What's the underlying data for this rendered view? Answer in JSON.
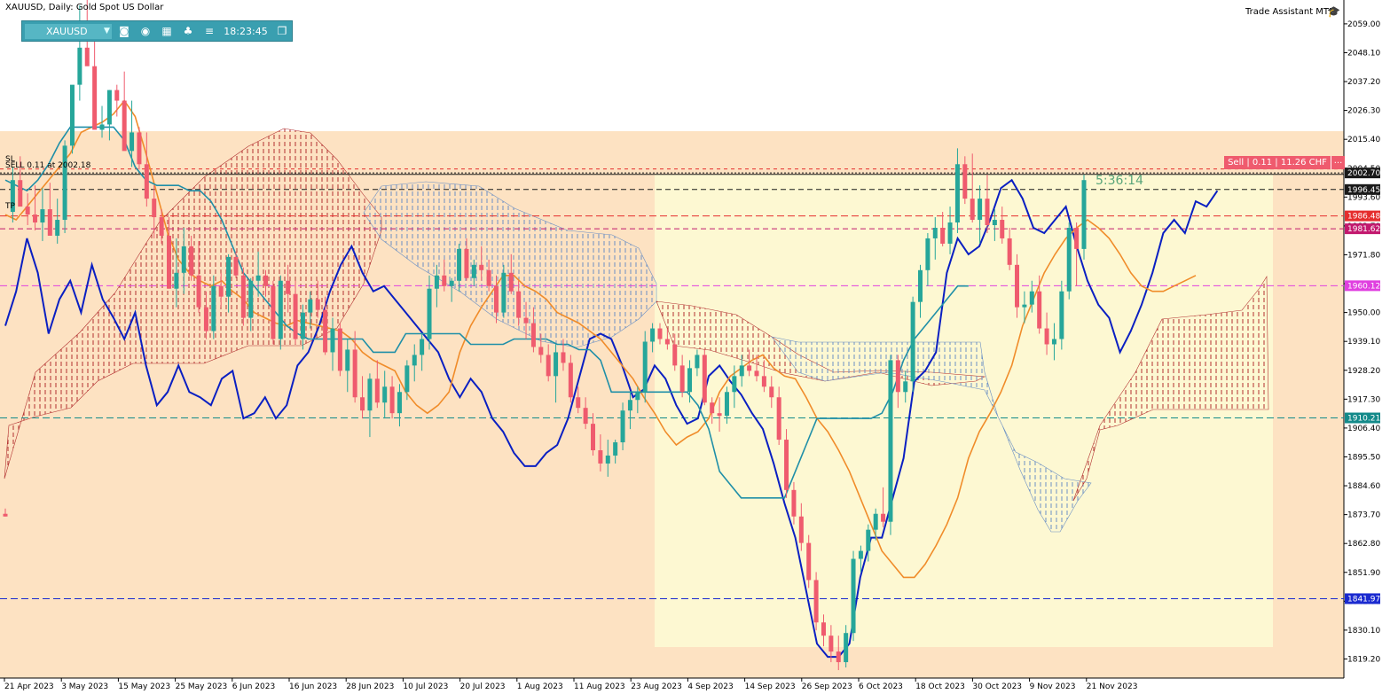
{
  "header": {
    "title": "XAUUSD, Daily:  Gold Spot US Dollar",
    "assistant": "Trade Assistant MT5"
  },
  "toolbar": {
    "symbol": "XAUUSD",
    "time": "18:23:45",
    "icons": [
      "camera-icon",
      "eye-icon",
      "calendar-icon",
      "bell-icon",
      "menu-icon",
      "window-icon"
    ]
  },
  "trade": {
    "sell_box": "Sell | 0.11 | 11.26 CHF",
    "sell_box_close": "...",
    "sl_label": "SL",
    "sell_label": "SELL 0.11 at 2002.18",
    "tp_label": "TP",
    "timer": "5:36:14"
  },
  "chart_data": {
    "type": "candlestick",
    "title": "XAUUSD, Daily:  Gold Spot US Dollar",
    "ylim": [
      1812,
      2068
    ],
    "y_ticks": [
      "2059.00",
      "2048.10",
      "2037.20",
      "2026.30",
      "2015.40",
      "2004.50",
      "1993.60",
      "1982.70",
      "1971.80",
      "1960.90",
      "1950.00",
      "1939.10",
      "1928.20",
      "1917.30",
      "1906.40",
      "1895.50",
      "1884.60",
      "1873.70",
      "1862.80",
      "1851.90",
      "1841.00",
      "1830.10",
      "1819.20"
    ],
    "x_ticks": [
      "21 Apr 2023",
      "3 May 2023",
      "15 May 2023",
      "25 May 2023",
      "6 Jun 2023",
      "16 Jun 2023",
      "28 Jun 2023",
      "10 Jul 2023",
      "20 Jul 2023",
      "1 Aug 2023",
      "11 Aug 2023",
      "23 Aug 2023",
      "4 Sep 2023",
      "14 Sep 2023",
      "26 Sep 2023",
      "6 Oct 2023",
      "18 Oct 2023",
      "30 Oct 2023",
      "9 Nov 2023",
      "21 Nov 2023"
    ],
    "price_labels": [
      {
        "value": 2002.7,
        "text": "2002.70",
        "color": "#1a1a1a"
      },
      {
        "value": 1996.45,
        "text": "1996.45",
        "color": "#1a1a1a"
      },
      {
        "value": 1986.48,
        "text": "1986.48",
        "color": "#e52d2d"
      },
      {
        "value": 1981.62,
        "text": "1981.62",
        "color": "#c2186e"
      },
      {
        "value": 1960.12,
        "text": "1960.12",
        "color": "#e040e0"
      },
      {
        "value": 1910.21,
        "text": "1910.21",
        "color": "#138a8a"
      },
      {
        "value": 1841.97,
        "text": "1841.97",
        "color": "#1a2ad0"
      }
    ],
    "bull_color": "#26a69a",
    "bear_color": "#ef5b6e",
    "candles": [
      [
        1874,
        1876,
        1873,
        1873
      ],
      [
        1988,
        2005,
        1984,
        2000
      ],
      [
        2000,
        2009,
        1993,
        1990
      ],
      [
        1990,
        1995,
        1983,
        1987
      ],
      [
        1987,
        1998,
        1981,
        1984
      ],
      [
        1984,
        1997,
        1977,
        1989
      ],
      [
        1989,
        1999,
        1980,
        1979
      ],
      [
        1979,
        1993,
        1976,
        1985
      ],
      [
        1985,
        2015,
        1980,
        2013
      ],
      [
        2013,
        2032,
        2010,
        2036
      ],
      [
        2036,
        2066,
        2030,
        2050
      ],
      [
        2050,
        2072,
        2045,
        2043
      ],
      [
        2043,
        2056,
        2023,
        2019
      ],
      [
        2019,
        2028,
        2016,
        2021
      ],
      [
        2021,
        2034,
        2015,
        2034
      ],
      [
        2034,
        2036,
        2024,
        2030
      ],
      [
        2030,
        2041,
        2014,
        2011
      ],
      [
        2011,
        2030,
        2005,
        2018
      ],
      [
        2018,
        2020,
        2004,
        2006
      ],
      [
        2006,
        2018,
        1990,
        1993
      ],
      [
        1993,
        1998,
        1978,
        1986
      ],
      [
        1986,
        1989,
        1976,
        1979
      ],
      [
        1979,
        1986,
        1959,
        1959
      ],
      [
        1959,
        1978,
        1952,
        1965
      ],
      [
        1965,
        1982,
        1957,
        1975
      ],
      [
        1975,
        1979,
        1962,
        1964
      ],
      [
        1964,
        1977,
        1950,
        1952
      ],
      [
        1952,
        1958,
        1940,
        1943
      ],
      [
        1943,
        1964,
        1940,
        1960
      ],
      [
        1960,
        1965,
        1952,
        1956
      ],
      [
        1956,
        1972,
        1950,
        1971
      ],
      [
        1971,
        1973,
        1963,
        1964
      ],
      [
        1964,
        1967,
        1945,
        1948
      ],
      [
        1948,
        1963,
        1943,
        1962
      ],
      [
        1962,
        1973,
        1956,
        1964
      ],
      [
        1964,
        1966,
        1956,
        1960
      ],
      [
        1960,
        1962,
        1938,
        1940
      ],
      [
        1940,
        1964,
        1936,
        1962
      ],
      [
        1962,
        1968,
        1950,
        1957
      ],
      [
        1957,
        1962,
        1938,
        1940
      ],
      [
        1940,
        1953,
        1936,
        1950
      ],
      [
        1950,
        1958,
        1944,
        1955
      ],
      [
        1955,
        1962,
        1948,
        1951
      ],
      [
        1951,
        1956,
        1934,
        1935
      ],
      [
        1935,
        1948,
        1928,
        1944
      ],
      [
        1944,
        1946,
        1926,
        1928
      ],
      [
        1928,
        1940,
        1920,
        1936
      ],
      [
        1936,
        1943,
        1916,
        1918
      ],
      [
        1918,
        1926,
        1910,
        1913
      ],
      [
        1913,
        1927,
        1903,
        1925
      ],
      [
        1925,
        1932,
        1914,
        1916
      ],
      [
        1916,
        1928,
        1910,
        1922
      ],
      [
        1922,
        1926,
        1910,
        1912
      ],
      [
        1912,
        1923,
        1907,
        1920
      ],
      [
        1920,
        1932,
        1917,
        1930
      ],
      [
        1930,
        1938,
        1924,
        1934
      ],
      [
        1934,
        1942,
        1928,
        1940
      ],
      [
        1940,
        1964,
        1936,
        1959
      ],
      [
        1959,
        1968,
        1952,
        1964
      ],
      [
        1964,
        1970,
        1958,
        1960
      ],
      [
        1960,
        1963,
        1954,
        1962
      ],
      [
        1962,
        1976,
        1958,
        1974
      ],
      [
        1974,
        1978,
        1962,
        1963
      ],
      [
        1963,
        1970,
        1960,
        1968
      ],
      [
        1968,
        1975,
        1962,
        1966
      ],
      [
        1966,
        1970,
        1958,
        1960
      ],
      [
        1960,
        1964,
        1946,
        1950
      ],
      [
        1950,
        1968,
        1948,
        1965
      ],
      [
        1965,
        1972,
        1957,
        1958
      ],
      [
        1958,
        1962,
        1945,
        1948
      ],
      [
        1948,
        1954,
        1940,
        1946
      ],
      [
        1946,
        1952,
        1935,
        1937
      ],
      [
        1937,
        1942,
        1931,
        1934
      ],
      [
        1934,
        1938,
        1924,
        1926
      ],
      [
        1926,
        1938,
        1916,
        1935
      ],
      [
        1935,
        1940,
        1928,
        1931
      ],
      [
        1931,
        1934,
        1916,
        1918
      ],
      [
        1918,
        1922,
        1912,
        1914
      ],
      [
        1914,
        1918,
        1906,
        1908
      ],
      [
        1908,
        1912,
        1896,
        1898
      ],
      [
        1898,
        1904,
        1890,
        1893
      ],
      [
        1893,
        1902,
        1888,
        1896
      ],
      [
        1896,
        1902,
        1893,
        1901
      ],
      [
        1901,
        1916,
        1898,
        1913
      ],
      [
        1913,
        1920,
        1906,
        1917
      ],
      [
        1917,
        1922,
        1912,
        1920
      ],
      [
        1920,
        1943,
        1916,
        1939
      ],
      [
        1939,
        1946,
        1935,
        1944
      ],
      [
        1944,
        1946,
        1938,
        1940
      ],
      [
        1940,
        1944,
        1936,
        1938
      ],
      [
        1938,
        1942,
        1928,
        1930
      ],
      [
        1930,
        1934,
        1918,
        1920
      ],
      [
        1920,
        1932,
        1916,
        1929
      ],
      [
        1929,
        1936,
        1926,
        1934
      ],
      [
        1934,
        1936,
        1915,
        1916
      ],
      [
        1916,
        1918,
        1908,
        1912
      ],
      [
        1912,
        1918,
        1905,
        1911
      ],
      [
        1911,
        1922,
        1908,
        1920
      ],
      [
        1920,
        1930,
        1914,
        1926
      ],
      [
        1926,
        1934,
        1922,
        1930
      ],
      [
        1930,
        1936,
        1926,
        1928
      ],
      [
        1928,
        1934,
        1924,
        1926
      ],
      [
        1926,
        1932,
        1920,
        1922
      ],
      [
        1922,
        1926,
        1914,
        1918
      ],
      [
        1918,
        1922,
        1900,
        1902
      ],
      [
        1902,
        1906,
        1880,
        1883
      ],
      [
        1883,
        1886,
        1870,
        1873
      ],
      [
        1873,
        1878,
        1860,
        1863
      ],
      [
        1863,
        1866,
        1846,
        1849
      ],
      [
        1849,
        1852,
        1830,
        1833
      ],
      [
        1833,
        1836,
        1824,
        1828
      ],
      [
        1828,
        1832,
        1818,
        1822
      ],
      [
        1822,
        1828,
        1815,
        1818
      ],
      [
        1818,
        1832,
        1816,
        1829
      ],
      [
        1829,
        1860,
        1826,
        1857
      ],
      [
        1857,
        1862,
        1852,
        1860
      ],
      [
        1860,
        1870,
        1856,
        1868
      ],
      [
        1868,
        1876,
        1864,
        1874
      ],
      [
        1874,
        1884,
        1869,
        1871
      ],
      [
        1871,
        1934,
        1866,
        1932
      ],
      [
        1932,
        1934,
        1914,
        1920
      ],
      [
        1920,
        1928,
        1916,
        1924
      ],
      [
        1924,
        1956,
        1920,
        1954
      ],
      [
        1954,
        1968,
        1948,
        1966
      ],
      [
        1966,
        1980,
        1960,
        1978
      ],
      [
        1978,
        1986,
        1970,
        1982
      ],
      [
        1982,
        1988,
        1975,
        1976
      ],
      [
        1976,
        1990,
        1972,
        1984
      ],
      [
        1984,
        2012,
        1980,
        2006
      ],
      [
        2006,
        2009,
        1991,
        1993
      ],
      [
        1993,
        2010,
        1984,
        1985
      ],
      [
        1985,
        1998,
        1976,
        1993
      ],
      [
        1993,
        2002,
        1980,
        1983
      ],
      [
        1983,
        1989,
        1977,
        1985
      ],
      [
        1985,
        1990,
        1976,
        1978
      ],
      [
        1978,
        1982,
        1966,
        1968
      ],
      [
        1968,
        1972,
        1948,
        1952
      ],
      [
        1952,
        1958,
        1946,
        1953
      ],
      [
        1953,
        1962,
        1950,
        1958
      ],
      [
        1958,
        1964,
        1942,
        1944
      ],
      [
        1944,
        1950,
        1934,
        1938
      ],
      [
        1938,
        1946,
        1932,
        1940
      ],
      [
        1940,
        1962,
        1936,
        1958
      ],
      [
        1958,
        1984,
        1955,
        1982
      ],
      [
        1982,
        1984,
        1960,
        1974
      ],
      [
        1974,
        2002,
        1970,
        2000
      ]
    ],
    "lines": [
      {
        "color": "#0a1fc2",
        "values": [
          1945,
          1958,
          1978,
          1965,
          1942,
          1955,
          1962,
          1950,
          1968,
          1955,
          1948,
          1940,
          1950,
          1930,
          1915,
          1920,
          1930,
          1920,
          1918,
          1915,
          1925,
          1928,
          1910,
          1912,
          1918,
          1910,
          1915,
          1930,
          1935,
          1945,
          1958,
          1968,
          1975,
          1965,
          1958,
          1960,
          1955,
          1950,
          1945,
          1940,
          1935,
          1925,
          1918,
          1925,
          1920,
          1910,
          1905,
          1897,
          1892,
          1892,
          1897,
          1900,
          1910,
          1925,
          1940,
          1942,
          1940,
          1930,
          1918,
          1921,
          1930,
          1925,
          1915,
          1908,
          1910,
          1926,
          1930,
          1924,
          1919,
          1912,
          1906,
          1893,
          1878,
          1865,
          1845,
          1825,
          1820,
          1820,
          1825,
          1850,
          1865,
          1865,
          1880,
          1895,
          1924,
          1928,
          1935,
          1965,
          1978,
          1972,
          1975,
          1985,
          1997,
          2000,
          1993,
          1982,
          1980,
          1985,
          1990,
          1975,
          1962,
          1953,
          1948,
          1935,
          1943,
          1953,
          1965,
          1980,
          1985,
          1980,
          1992,
          1990,
          1996
        ]
      },
      {
        "color": "#f08c2a",
        "values": [
          1987,
          1985,
          1990,
          1995,
          2000,
          2005,
          2010,
          2018,
          2020,
          2022,
          2025,
          2030,
          2024,
          2010,
          1995,
          1980,
          1970,
          1965,
          1962,
          1960,
          1962,
          1958,
          1955,
          1950,
          1948,
          1946,
          1945,
          1947,
          1946,
          1945,
          1944,
          1943,
          1940,
          1935,
          1932,
          1930,
          1928,
          1920,
          1915,
          1912,
          1915,
          1920,
          1935,
          1945,
          1952,
          1958,
          1964,
          1964,
          1960,
          1958,
          1955,
          1950,
          1948,
          1946,
          1943,
          1940,
          1935,
          1930,
          1925,
          1918,
          1912,
          1905,
          1900,
          1903,
          1905,
          1910,
          1920,
          1926,
          1929,
          1932,
          1934,
          1929,
          1926,
          1925,
          1918,
          1910,
          1905,
          1898,
          1890,
          1880,
          1870,
          1860,
          1855,
          1850,
          1850,
          1855,
          1862,
          1870,
          1880,
          1895,
          1905,
          1912,
          1920,
          1930,
          1945,
          1955,
          1965,
          1972,
          1978,
          1982,
          1985,
          1982,
          1978,
          1972,
          1965,
          1960,
          1958,
          1958,
          1960,
          1962,
          1964
        ]
      },
      {
        "color": "#1f8fa8",
        "values": [
          2000,
          1998,
          1996,
          2000,
          2006,
          2014,
          2020,
          2020,
          2020,
          2020,
          2020,
          2015,
          2005,
          2000,
          1998,
          1998,
          1998,
          1996,
          1996,
          1992,
          1985,
          1975,
          1965,
          1960,
          1955,
          1950,
          1945,
          1942,
          1940,
          1940,
          1940,
          1940,
          1940,
          1940,
          1935,
          1935,
          1935,
          1942,
          1942,
          1942,
          1942,
          1942,
          1942,
          1938,
          1938,
          1938,
          1938,
          1940,
          1940,
          1940,
          1940,
          1938,
          1938,
          1936,
          1936,
          1932,
          1920,
          1920,
          1920,
          1920,
          1920,
          1920,
          1920,
          1920,
          1915,
          1906,
          1890,
          1885,
          1880,
          1880,
          1880,
          1880,
          1880,
          1890,
          1900,
          1910,
          1910,
          1910,
          1910,
          1910,
          1910,
          1912,
          1920,
          1932,
          1940,
          1945,
          1950,
          1955,
          1960,
          1960
        ]
      }
    ]
  }
}
